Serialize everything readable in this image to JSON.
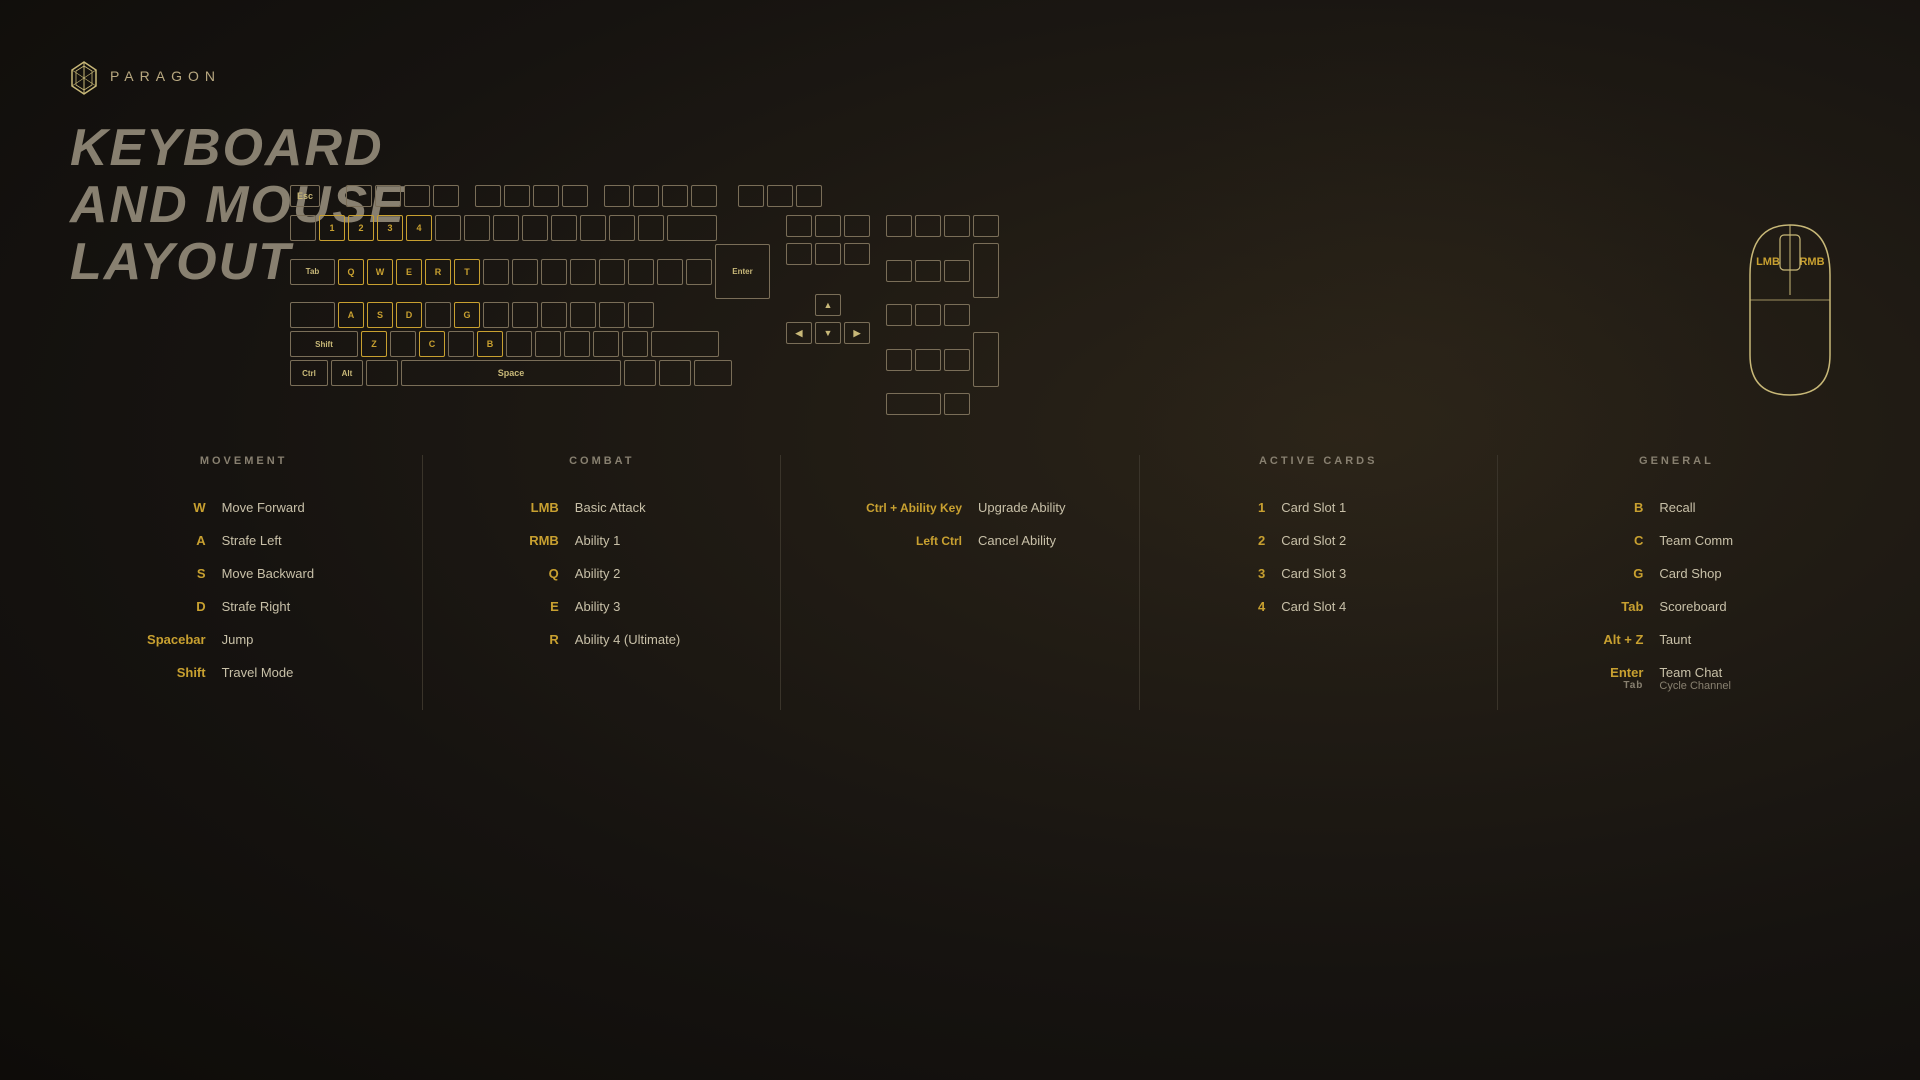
{
  "logo": {
    "text": "PARAGON"
  },
  "title": {
    "line1": "KEYBOARD",
    "line2": "AND MOUSE",
    "line3": "LAYOUT"
  },
  "sections": {
    "movement": {
      "title": "MOVEMENT",
      "binds": [
        {
          "key": "W",
          "action": "Move Forward"
        },
        {
          "key": "A",
          "action": "Strafe Left"
        },
        {
          "key": "S",
          "action": "Move Backward"
        },
        {
          "key": "D",
          "action": "Strafe Right"
        },
        {
          "key": "Spacebar",
          "action": "Jump"
        },
        {
          "key": "Shift",
          "action": "Travel Mode"
        }
      ]
    },
    "combat": {
      "title": "COMBAT",
      "binds": [
        {
          "key": "LMB",
          "action": "Basic Attack"
        },
        {
          "key": "RMB",
          "action": "Ability 1"
        },
        {
          "key": "Q",
          "action": "Ability 2"
        },
        {
          "key": "E",
          "action": "Ability 3"
        },
        {
          "key": "R",
          "action": "Ability 4 (Ultimate)"
        }
      ]
    },
    "combat2": {
      "binds": [
        {
          "key": "Ctrl + Ability Key",
          "action": "Upgrade Ability"
        },
        {
          "key": "Left Ctrl",
          "action": "Cancel Ability"
        }
      ]
    },
    "active_cards": {
      "title": "ACTIVE CARDS",
      "binds": [
        {
          "key": "1",
          "action": "Card Slot 1"
        },
        {
          "key": "2",
          "action": "Card Slot 2"
        },
        {
          "key": "3",
          "action": "Card Slot 3"
        },
        {
          "key": "4",
          "action": "Card Slot 4"
        }
      ]
    },
    "general": {
      "title": "GENERAL",
      "binds": [
        {
          "key": "B",
          "action": "Recall"
        },
        {
          "key": "C",
          "action": "Team Comm"
        },
        {
          "key": "G",
          "action": "Card Shop"
        },
        {
          "key": "Tab",
          "action": "Scoreboard"
        },
        {
          "key": "Alt + Z",
          "action": "Taunt"
        },
        {
          "key": "Enter",
          "action": "Team Chat",
          "sub": "Tab",
          "subAction": "Cycle Channel"
        }
      ]
    }
  },
  "mouse": {
    "lmb": "LMB",
    "rmb": "RMB"
  }
}
